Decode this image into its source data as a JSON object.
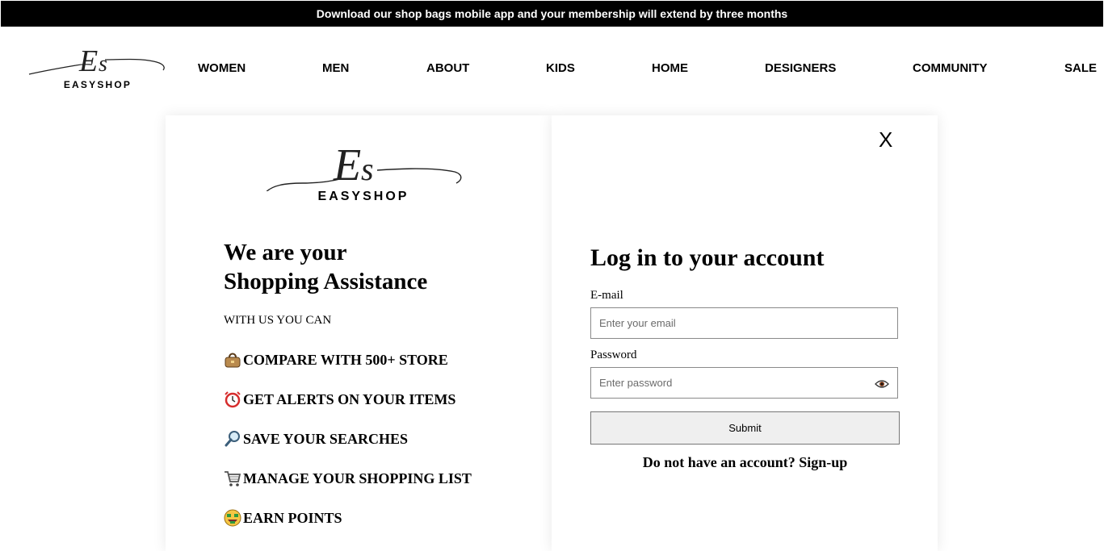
{
  "banner": {
    "text": "Download our shop bags mobile app and your membership will extend by three months"
  },
  "brand": {
    "name": "EASYSHOP"
  },
  "nav": {
    "items": [
      {
        "label": "WOMEN"
      },
      {
        "label": "MEN"
      },
      {
        "label": "ABOUT"
      },
      {
        "label": "KIDS"
      },
      {
        "label": "HOME"
      },
      {
        "label": "DESIGNERS"
      },
      {
        "label": "COMMUNITY"
      },
      {
        "label": "SALE"
      }
    ]
  },
  "assist": {
    "title_line1": "We are your",
    "title_line2": "Shopping Assistance",
    "subtitle": "WITH US YOU CAN",
    "features": [
      {
        "icon": "handbag-icon",
        "label": "COMPARE WITH 500+ STORE"
      },
      {
        "icon": "alarm-clock-icon",
        "label": "GET ALERTS ON YOUR ITEMS"
      },
      {
        "icon": "magnifier-icon",
        "label": "SAVE YOUR SEARCHES"
      },
      {
        "icon": "shopping-cart-icon",
        "label": "MANAGE YOUR SHOPPING LIST"
      },
      {
        "icon": "money-face-icon",
        "label": "EARN POINTS"
      }
    ]
  },
  "login": {
    "close_label": "X",
    "title": "Log in to your account",
    "email_label": "E-mail",
    "email_placeholder": "Enter your email",
    "password_label": "Password",
    "password_placeholder": "Enter password",
    "submit_label": "Submit",
    "signup_text": "Do not have an account? Sign-up"
  }
}
